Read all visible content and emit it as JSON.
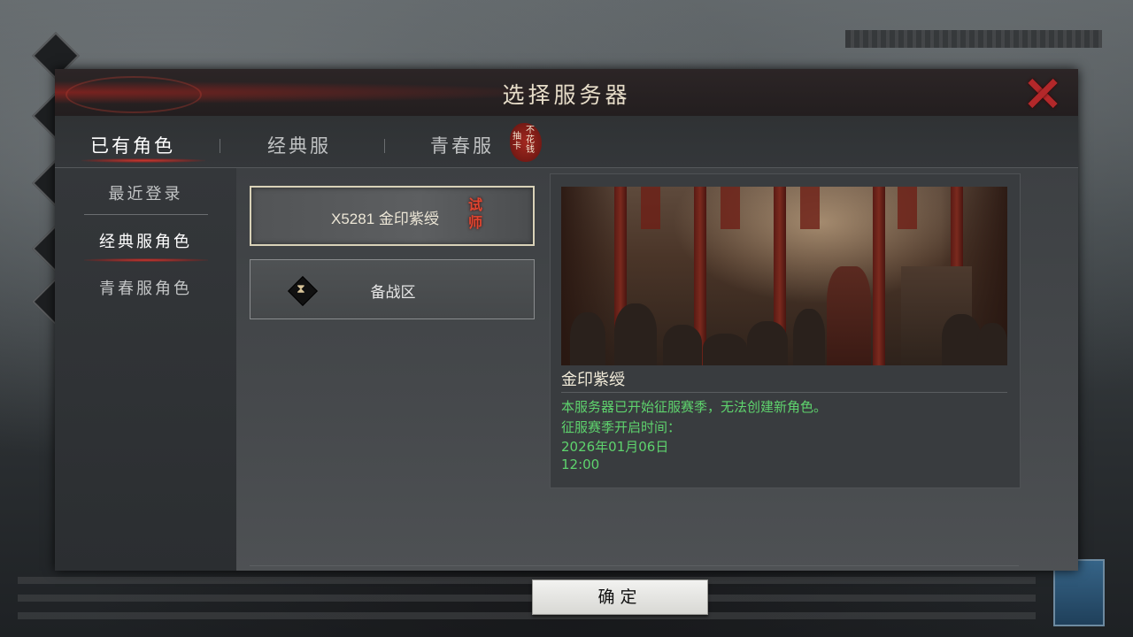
{
  "dialog": {
    "title": "选择服务器",
    "close_icon": "close-icon"
  },
  "tabs": [
    {
      "label": "已有角色",
      "active": true
    },
    {
      "label": "经典服",
      "active": false
    },
    {
      "label": "青春服",
      "active": false
    }
  ],
  "promo_seal": {
    "line1": "抽卡",
    "line2": "不花钱"
  },
  "sidebar": {
    "items": [
      {
        "label": "最近登录",
        "active": false
      },
      {
        "label": "经典服角色",
        "active": true
      },
      {
        "label": "青春服角色",
        "active": false
      }
    ]
  },
  "servers": [
    {
      "name": "X5281 金印紫绶",
      "badge": "试师",
      "selected": true
    },
    {
      "name": "备战区",
      "icon": "hourglass-icon",
      "selected": false
    }
  ],
  "info": {
    "title": "金印紫绶",
    "lines": [
      "本服务器已开始征服赛季，无法创建新角色。",
      "征服赛季开启时间：",
      "2026年01月06日",
      "12:00"
    ]
  },
  "confirm_label": "确定",
  "colors": {
    "accent_red": "#b3282a",
    "info_green": "#5ed36d",
    "title_text": "#e6dcc8"
  }
}
